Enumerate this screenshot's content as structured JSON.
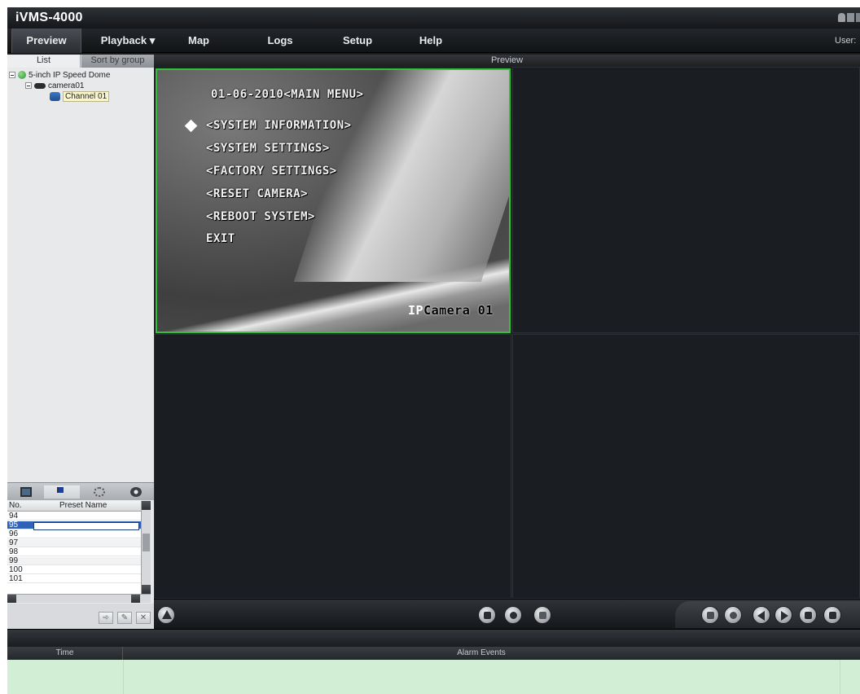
{
  "app": {
    "title": "iVMS-4000",
    "user_label": "User:"
  },
  "menu": {
    "items": [
      {
        "label": "Preview",
        "active": true
      },
      {
        "label": "Playback ▾"
      },
      {
        "label": "Map"
      },
      {
        "label": "Logs"
      },
      {
        "label": "Setup"
      },
      {
        "label": "Help"
      }
    ]
  },
  "left_panel": {
    "tabs": [
      "List",
      "Sort by group"
    ],
    "tree": {
      "root": "5-inch IP Speed Dome",
      "device": "camera01",
      "channel": "Channel 01"
    },
    "ptz_tabs": [
      "monitor-icon",
      "flag-icon",
      "tour-icon",
      "pattern-icon"
    ],
    "preset_table": {
      "columns": [
        "No.",
        "Preset Name"
      ],
      "rows": [
        {
          "no": "94",
          "name": ""
        },
        {
          "no": "95",
          "name": "",
          "selected": true
        },
        {
          "no": "96",
          "name": ""
        },
        {
          "no": "97",
          "name": ""
        },
        {
          "no": "98",
          "name": ""
        },
        {
          "no": "99",
          "name": ""
        },
        {
          "no": "100",
          "name": ""
        },
        {
          "no": "101",
          "name": ""
        }
      ]
    },
    "preset_actions": [
      "call-preset-icon",
      "set-preset-icon",
      "delete-preset-icon"
    ]
  },
  "preview": {
    "header": "Preview",
    "active_cell_border_color": "#32c23a",
    "osd": {
      "title": "01-06-2010<MAIN MENU>",
      "items": [
        "<SYSTEM INFORMATION>",
        "<SYSTEM SETTINGS>",
        "<FACTORY SETTINGS>",
        "<RESET CAMERA>",
        "<REBOOT SYSTEM>",
        "EXIT"
      ],
      "selected_index": 0,
      "camera_name_prefix": "IP",
      "camera_name": "Camera 01"
    }
  },
  "toolbar": {
    "left": [
      "alarm-icon"
    ],
    "center": [
      "stop-all-icon",
      "record-all-icon",
      "capture-icon"
    ],
    "right": [
      "layout-icon",
      "fullscreen-icon",
      "prev-page-icon",
      "next-page-icon",
      "auto-switch-icon",
      "save-view-icon"
    ]
  },
  "alarm_panel": {
    "columns": [
      "Time",
      "Alarm Events"
    ],
    "body_color": "#d2efd5"
  }
}
